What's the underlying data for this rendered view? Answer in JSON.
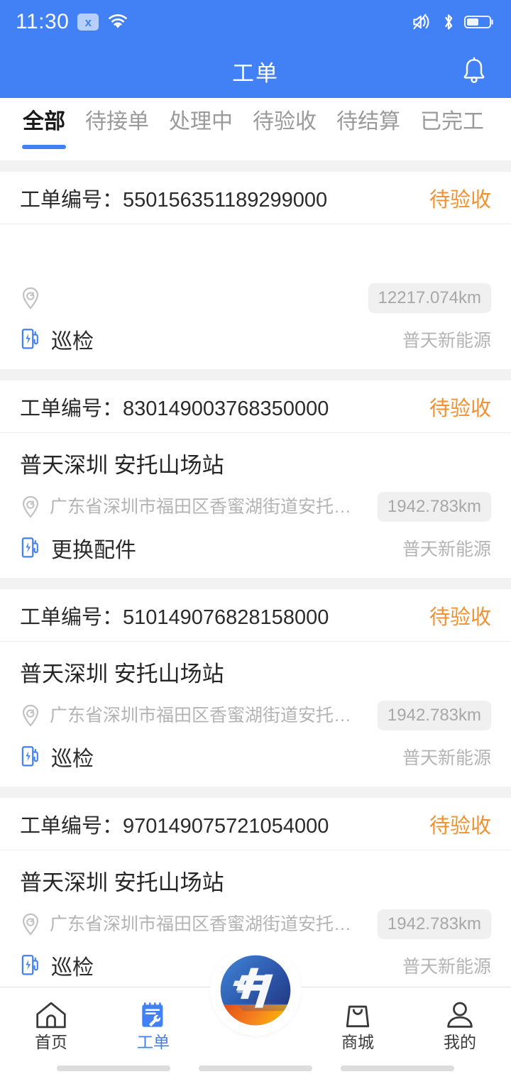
{
  "statusbar": {
    "time": "11:30",
    "no_sim_badge": "x",
    "icons": [
      "no-sim-icon",
      "wifi-icon",
      "volume-mute-icon",
      "bluetooth-icon",
      "battery-icon"
    ],
    "battery_level_percent": 50
  },
  "header": {
    "title": "工单",
    "bell_icon": "bell-icon",
    "background_color": "#4180F5",
    "text_color": "#FFFFFF"
  },
  "tabs": {
    "active_index": 0,
    "items": [
      {
        "label": "全部"
      },
      {
        "label": "待接单"
      },
      {
        "label": "处理中"
      },
      {
        "label": "待验收"
      },
      {
        "label": "待结算"
      },
      {
        "label": "已完工"
      }
    ],
    "active_color": "#1A1A1A",
    "inactive_color": "#9A9A9A",
    "underline_color": "#4180F5"
  },
  "list": {
    "order_no_label": "工单编号：",
    "status_color": "#F09233",
    "cards": [
      {
        "order_no_label": "工单编号：",
        "order_no": "550156351189299000",
        "status": "待验收",
        "station_name": "",
        "address": "",
        "distance": "12217.074km",
        "work_type": "巡检",
        "vendor": "普天新能源"
      },
      {
        "order_no_label": "工单编号：",
        "order_no": "830149003768350000",
        "status": "待验收",
        "station_name": "普天深圳 安托山场站",
        "address": "广东省深圳市福田区香蜜湖街道安托山大…",
        "distance": "1942.783km",
        "work_type": "更换配件",
        "vendor": "普天新能源"
      },
      {
        "order_no_label": "工单编号：",
        "order_no": "510149076828158000",
        "status": "待验收",
        "station_name": "普天深圳 安托山场站",
        "address": "广东省深圳市福田区香蜜湖街道安托山大…",
        "distance": "1942.783km",
        "work_type": "巡检",
        "vendor": "普天新能源"
      },
      {
        "order_no_label": "工单编号：",
        "order_no": "970149075721054000",
        "status": "待验收",
        "station_name": "普天深圳 安托山场站",
        "address": "广东省深圳市福田区香蜜湖街道安托山大…",
        "distance": "1942.783km",
        "work_type": "巡检",
        "vendor": "普天新能源"
      }
    ]
  },
  "bottomnav": {
    "active_index": 1,
    "active_color": "#4180F5",
    "inactive_color": "#3A3A3A",
    "items": [
      {
        "label": "首页",
        "icon": "home-icon"
      },
      {
        "label": "工单",
        "icon": "clipboard-wrench-icon"
      },
      {
        "label": "商城",
        "icon": "shopping-bag-icon"
      },
      {
        "label": "我的",
        "icon": "person-icon"
      }
    ],
    "center_button": {
      "icon": "brand-logo-icon"
    }
  }
}
